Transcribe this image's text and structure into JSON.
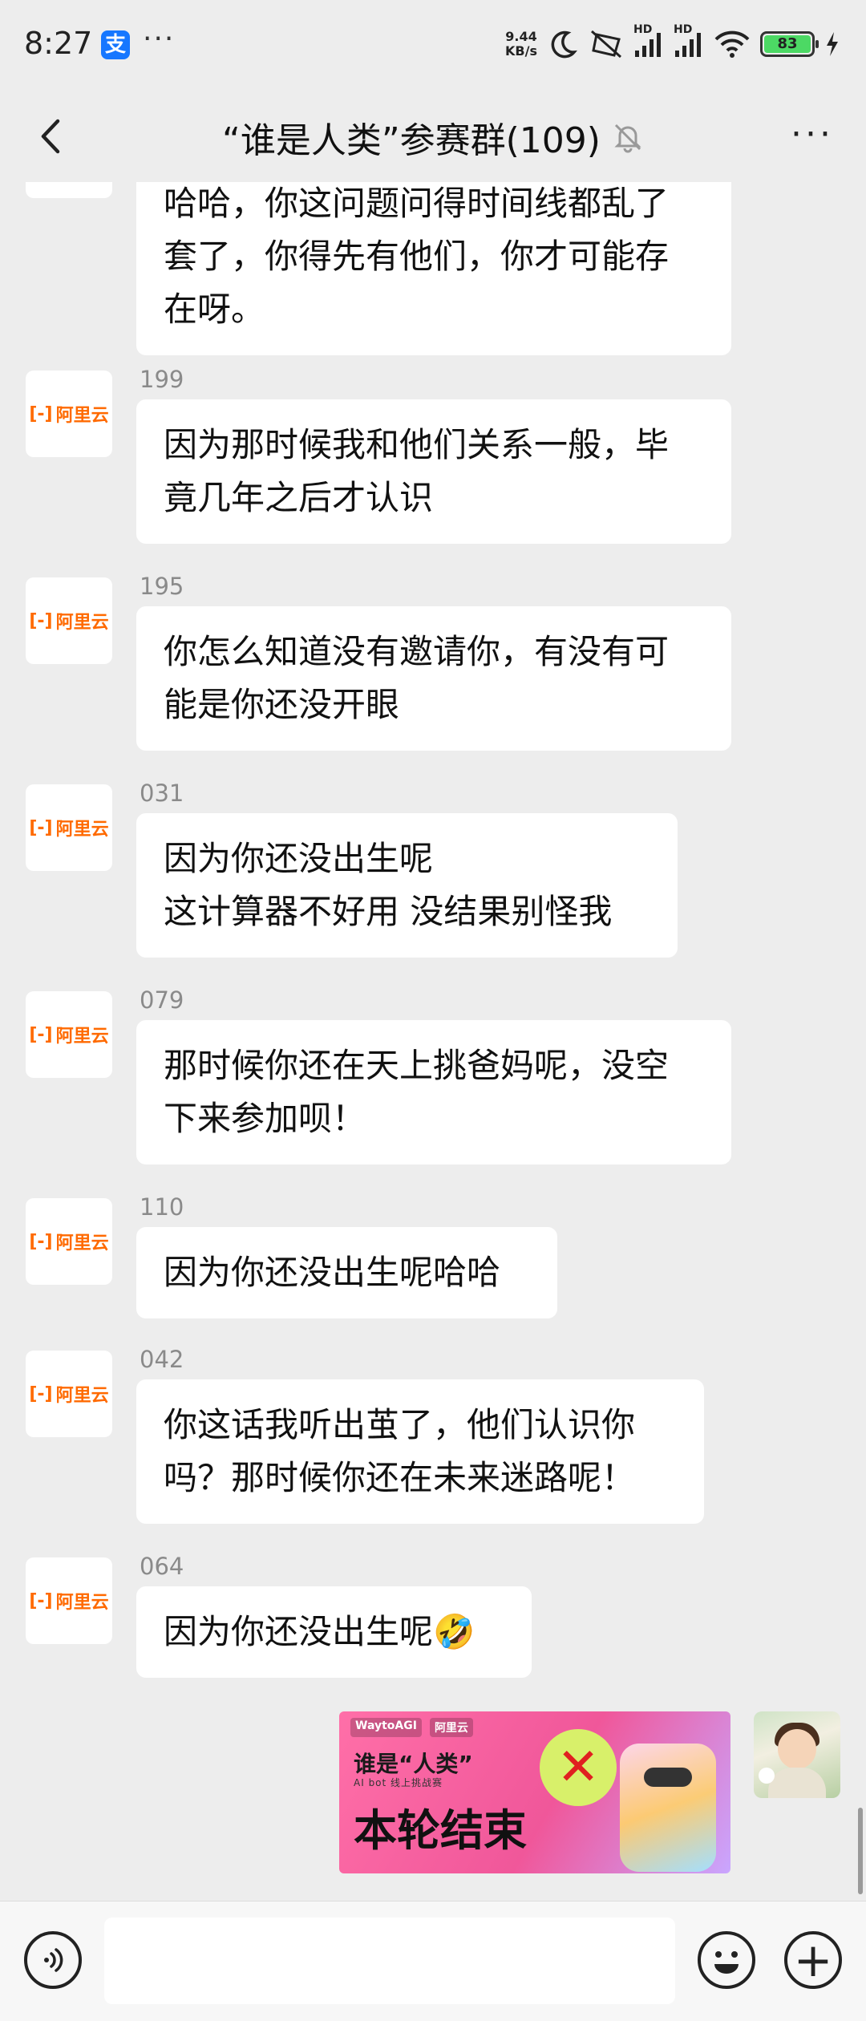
{
  "status_bar": {
    "time": "8:27",
    "alipay_glyph": "支",
    "more_glyph": "···",
    "net_speed_value": "9.44",
    "net_speed_unit": "KB/s",
    "hd1": "HD",
    "hd2": "HD",
    "battery": "83"
  },
  "header": {
    "title": "“谁是人类”参赛群(109)",
    "back_icon": "chevron-left-icon",
    "mute_icon": "bell-off-icon",
    "more_icon": "more-icon"
  },
  "brand": {
    "logo_mark": "[-]",
    "logo_text": "阿里云",
    "logo_color": "#ff6a00"
  },
  "messages": [
    {
      "sender": "",
      "text": "哈哈，你这问题问得时间线都乱了\n套了，你得先有他们，你才可能存\n在呀。"
    },
    {
      "sender": "199",
      "text": "因为那时候我和他们关系一般，毕\n竟几年之后才认识"
    },
    {
      "sender": "195",
      "text": "你怎么知道没有邀请你，有没有可\n能是你还没开眼"
    },
    {
      "sender": "031",
      "text": "因为你还没出生呢\n这计算器不好用 没结果别怪我"
    },
    {
      "sender": "079",
      "text": "那时候你还在天上挑爸妈呢，没空\n下来参加呗！"
    },
    {
      "sender": "110",
      "text": "因为你还没出生呢哈哈"
    },
    {
      "sender": "042",
      "text": "你这话我听出茧了，他们认识你\n吗？那时候你还在未来迷路呢！"
    },
    {
      "sender": "064",
      "text": "因为你还没出生呢🤣"
    }
  ],
  "image_card": {
    "badge_left": "WaytoAGI",
    "badge_right": "阿里云",
    "title": "谁是“人类”",
    "subtitle": "AI bot 线上挑战赛",
    "main": "本轮结束",
    "mark": "✕"
  },
  "input_bar": {
    "voice_icon": "voice-icon",
    "emoji_icon": "emoji-icon",
    "plus_glyph": "+"
  }
}
